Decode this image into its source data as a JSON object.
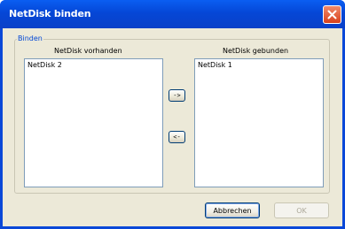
{
  "window": {
    "title": "NetDisk binden",
    "close_icon": "close-icon"
  },
  "group": {
    "label": "Binden"
  },
  "available": {
    "caption": "NetDisk vorhanden",
    "items": [
      "NetDisk 2"
    ]
  },
  "bound": {
    "caption": "NetDisk gebunden",
    "items": [
      "NetDisk 1"
    ]
  },
  "move": {
    "to_right_label": "->",
    "to_left_label": "<-"
  },
  "buttons": {
    "cancel_label": "Abbrechen",
    "ok_label": "OK"
  },
  "colors": {
    "titlebar": "#0a48d8",
    "dialog_background": "#ece9d8",
    "group_label": "#0046d5"
  }
}
